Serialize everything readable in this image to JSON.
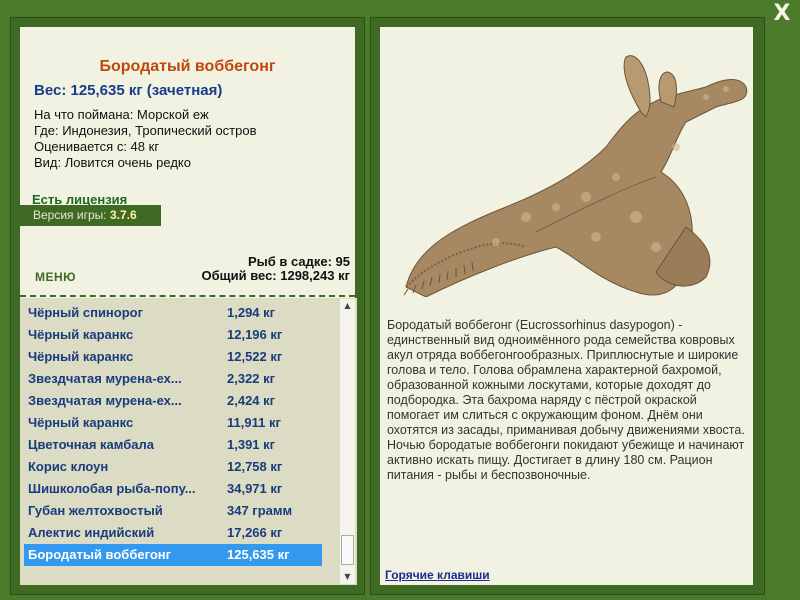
{
  "fish": {
    "name": "Бородатый воббегонг",
    "weight": "Вес: 125,635 кг (зачетная)",
    "bait": "На что поймана: Морской еж",
    "location": "Где: Индонезия, Тропический остров",
    "value": "Оценивается с: 48 кг",
    "rarity": "Вид: Ловится очень редко"
  },
  "license": "Есть лицензия",
  "version": {
    "label": "Версия игры: ",
    "number": "3.7.6"
  },
  "menu_label": "МЕНЮ",
  "stats": {
    "fish_count": "Рыб в садке: 95",
    "total_weight": "Общий вес: 1298,243 кг"
  },
  "catch_list": [
    {
      "name": "Чёрный спинорог",
      "weight": "1,294 кг"
    },
    {
      "name": "Чёрный каранкс",
      "weight": "12,196 кг"
    },
    {
      "name": "Чёрный каранкс",
      "weight": "12,522 кг"
    },
    {
      "name": "Звездчатая мурена-ех...",
      "weight": "2,322 кг"
    },
    {
      "name": "Звездчатая мурена-ех...",
      "weight": "2,424 кг"
    },
    {
      "name": "Чёрный каранкс",
      "weight": "11,911 кг"
    },
    {
      "name": "Цветочная камбала",
      "weight": "1,391 кг"
    },
    {
      "name": "Корис клоун",
      "weight": "12,758 кг"
    },
    {
      "name": "Шишколобая рыба-попу...",
      "weight": "34,971 кг"
    },
    {
      "name": "Губан желтохвостый",
      "weight": "347 грамм"
    },
    {
      "name": "Алектис индийский",
      "weight": "17,266 кг"
    },
    {
      "name": "Бородатый воббегонг",
      "weight": "125,635 кг"
    }
  ],
  "selected_index": 11,
  "description": "Бородатый воббегонг (Eucrossorhinus dasypogon) - единственный вид одноимённого рода семейства ковровых акул отряда воббегонгообразных. Приплюснутые и широкие голова и тело. Голова обрамлена характерной бахромой, образованной кожными лоскутами, которые доходят до подбородка. Эта бахрома наряду с пёстрой окраской помогает им слиться с окружающим фоном. Днём они охотятся из засады, приманивая добычу движениями хвоста. Ночью бородатые воббегонги покидают убежище и начинают активно искать пищу. Достигает в длину 180 см. Рацион питания - рыбы и беспозвоночные.",
  "hotkeys_link": "Горячие клавиши",
  "close_symbol": "X",
  "scroll_up": "▲",
  "scroll_down": "▼",
  "colors": {
    "background": "#4a7a2a",
    "panel": "#3f6a24",
    "card": "#f2f2e2",
    "title": "#c0480c",
    "list_text": "#183c7c",
    "selection": "#3399ee"
  }
}
